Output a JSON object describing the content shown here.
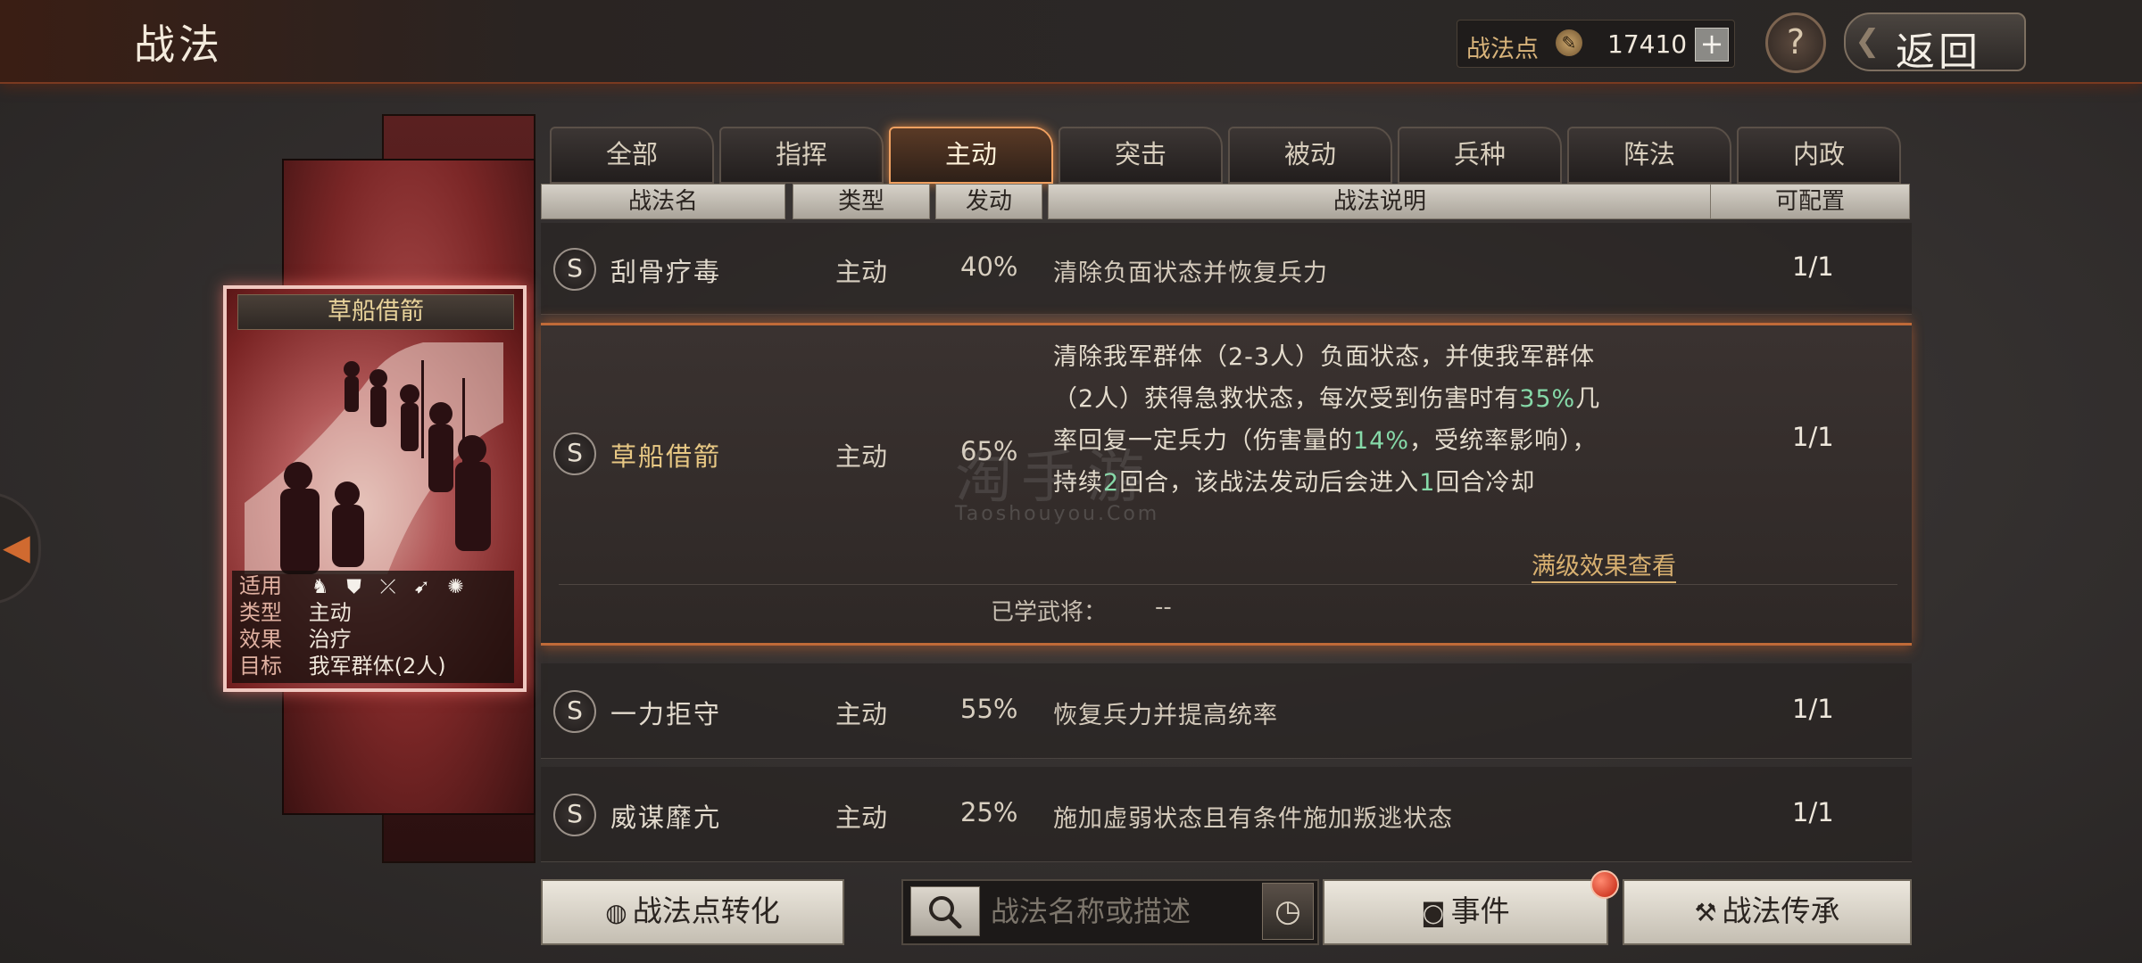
{
  "header": {
    "title": "战法",
    "points_label": "战法点",
    "points_value": "17410",
    "plus": "+",
    "help": "?",
    "back": "返回"
  },
  "card": {
    "title": "草船借箭",
    "apply_label": "适用",
    "type_label": "类型",
    "type_value": "主动",
    "effect_label": "效果",
    "effect_value": "治疗",
    "target_label": "目标",
    "target_value": "我军群体(2人)",
    "troop_icons": [
      "cavalry-icon",
      "shield-icon",
      "bow-icon",
      "spear-icon",
      "wheel-icon"
    ]
  },
  "tabs": [
    "全部",
    "指挥",
    "主动",
    "突击",
    "被动",
    "兵种",
    "阵法",
    "内政"
  ],
  "active_tab": "主动",
  "columns": {
    "name": "战法名",
    "type": "类型",
    "rate": "发动",
    "desc": "战法说明",
    "configurable": "可配置"
  },
  "rows": [
    {
      "grade": "S",
      "name": "刮骨疗毒",
      "type": "主动",
      "rate": "40%",
      "desc": "清除负面状态并恢复兵力",
      "configurable": "1/1"
    },
    {
      "grade": "S",
      "name": "草船借箭",
      "type": "主动",
      "rate": "65%",
      "desc_parts": [
        "清除我军群体（2-3人）负面状态，并使我军群体",
        "（2人）获得急救状态，每次受到伤害时有",
        "35%",
        "几",
        "率回复一定兵力（伤害量的",
        "14%",
        "，受统率影响），",
        "持续",
        "2",
        "回合，该战法发动后会进入",
        "1",
        "回合冷却"
      ],
      "configurable": "1/1",
      "full_effect": "满级效果查看",
      "learned_label": "已学武将：",
      "learned_value": "--"
    },
    {
      "grade": "S",
      "name": "一力拒守",
      "type": "主动",
      "rate": "55%",
      "desc": "恢复兵力并提高统率",
      "configurable": "1/1"
    },
    {
      "grade": "S",
      "name": "威谋靡亢",
      "type": "主动",
      "rate": "25%",
      "desc": "施加虚弱状态且有条件施加叛逃状态",
      "configurable": "1/1"
    }
  ],
  "watermark": {
    "cn": "淘手游",
    "en": "Taoshouyou.Com"
  },
  "bottom": {
    "convert": "战法点转化",
    "search_placeholder": "战法名称或描述",
    "event": "事件",
    "inherit": "战法传承"
  },
  "colors": {
    "accent": "#f0a060",
    "highlight": "#86d9a8",
    "gold": "#e8c884"
  }
}
